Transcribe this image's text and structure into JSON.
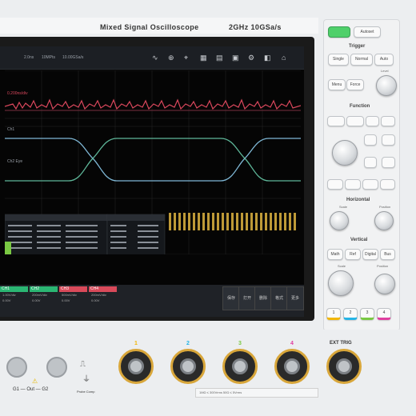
{
  "header": {
    "model": "Mixed Signal Oscilloscope",
    "spec": "2GHz  10GSa/s"
  },
  "toolbar": {
    "time_div": "2.0ns",
    "rate": "10MPts",
    "sample": "10.00GSa/s"
  },
  "waveform_labels": {
    "top": "0.200ns/div",
    "mid": "Ch1",
    "eye": "Ch2 Eye"
  },
  "channels": [
    {
      "name": "CH1",
      "color": "#2bb673",
      "l1": "1.00V/div",
      "l2": "0.00V"
    },
    {
      "name": "CH2",
      "color": "#2bb673",
      "l1": "200mV/div",
      "l2": "0.00V"
    },
    {
      "name": "CH3",
      "color": "#d94a5a",
      "l1": "500mV/div",
      "l2": "0.00V"
    },
    {
      "name": "CH4",
      "color": "#d94a5a",
      "l1": "200mV/div",
      "l2": "0.00V"
    }
  ],
  "softkeys": [
    "保存",
    "打开",
    "删除",
    "格式",
    "更多"
  ],
  "panel": {
    "top_left": "",
    "top_right": "Autoset",
    "trigger": "Trigger",
    "trig_buttons": [
      "Single",
      "Normal",
      "Auto"
    ],
    "trig_buttons2": [
      "Menu",
      "Force"
    ],
    "level": "Level",
    "function": "Function",
    "horizontal": "Horizontal",
    "h_scale": "Scale",
    "h_position": "Position",
    "vertical": "Vertical",
    "v_scale": "Scale",
    "v_position": "Position",
    "vert_buttons": [
      "Math",
      "Ref",
      "Digital",
      "Bus"
    ],
    "ch_buttons": [
      "1",
      "2",
      "3",
      "4"
    ]
  },
  "front": {
    "ch1": "1",
    "ch2": "2",
    "ch3": "3",
    "ch4": "4",
    "ext": "EXT TRIG",
    "gen": "G1 — Out — G2",
    "probe": "Probe Comp",
    "warning": "1MΩ ≤ 300Vrms  50Ω ≤ 5Vrms",
    "ch_colors": [
      "#f2b705",
      "#26b5e6",
      "#7ac943",
      "#e040a0"
    ]
  }
}
